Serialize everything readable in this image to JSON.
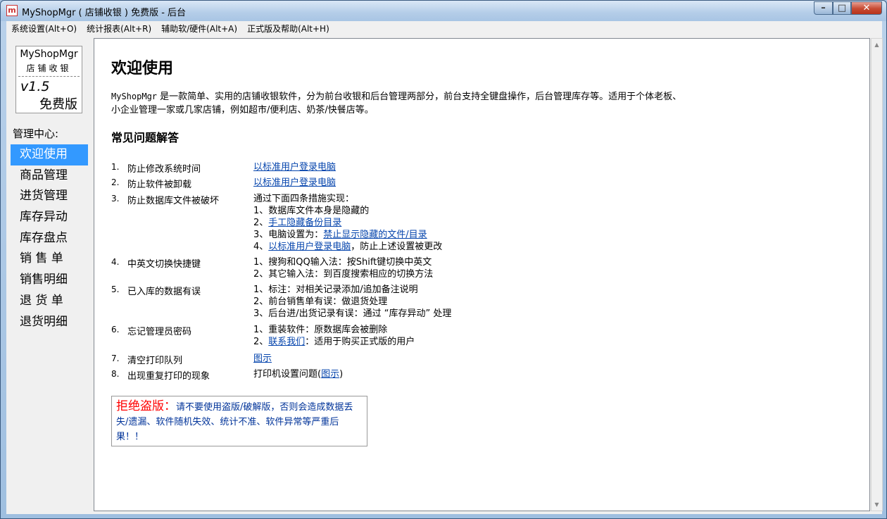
{
  "window": {
    "icon_glyph": "m",
    "title": "MyShopMgr ( 店铺收银 ) 免费版 - 后台",
    "btn_min": "–",
    "btn_max": "□",
    "btn_close": "✕"
  },
  "menu": [
    "系统设置(Alt+O)",
    "统计报表(Alt+R)",
    "辅助软/硬件(Alt+A)",
    "正式版及帮助(Alt+H)"
  ],
  "logo": {
    "name": "MyShopMgr",
    "sub": "店铺收银",
    "version": "v1.5",
    "edition": "免费版"
  },
  "nav": {
    "title": "管理中心:",
    "items": [
      "欢迎使用",
      "商品管理",
      "进货管理",
      "库存异动",
      "库存盘点",
      "销 售 单",
      "销售明细",
      "退 货 单",
      "退货明细"
    ],
    "active_index": 0
  },
  "main": {
    "heading": "欢迎使用",
    "intro_app": "MyShopMgr",
    "intro": " 是一款简单、实用的店铺收银软件，分为前台收银和后台管理两部分，前台支持全键盘操作，后台管理库存等。适用于个体老板、小企业管理一家或几家店铺，例如超市/便利店、奶茶/快餐店等。",
    "faq_heading": "常见问题解答",
    "faq": [
      {
        "num": "1.",
        "q": "防止修改系统时间",
        "a_link": "以标准用户登录电脑"
      },
      {
        "num": "2.",
        "q": "防止软件被卸载",
        "a_link": "以标准用户登录电脑"
      },
      {
        "num": "3.",
        "q": "防止数据库文件被破坏",
        "a_intro": "通过下面四条措施实现：",
        "a1": "1、数据库文件本身是隐藏的",
        "a2_pre": "2、",
        "a2_link": "手工隐藏备份目录",
        "a3_pre": "3、电脑设置为：",
        "a3_link": "禁止显示隐藏的文件/目录",
        "a4_pre": "4、",
        "a4_link": "以标准用户登录电脑",
        "a4_post": "，防止上述设置被更改"
      },
      {
        "num": "4.",
        "q": "中英文切换快捷键",
        "a1": "1、搜狗和QQ输入法：按Shift键切换中英文",
        "a2": "2、其它输入法：到百度搜索相应的切换方法"
      },
      {
        "num": "5.",
        "q": "已入库的数据有误",
        "a1": "1、标注：对相关记录添加/追加备注说明",
        "a2": "2、前台销售单有误：做退货处理",
        "a3": "3、后台进/出货记录有误：通过 “库存异动” 处理"
      },
      {
        "num": "6.",
        "q": "忘记管理员密码",
        "a1": "1、重装软件：原数据库会被删除",
        "a2_pre": "2、",
        "a2_link": "联系我们",
        "a2_post": "：适用于购买正式版的用户"
      },
      {
        "num": "7.",
        "q": "清空打印队列",
        "a_link": "图示"
      },
      {
        "num": "8.",
        "q": "出现重复打印的现象",
        "a_pre": "打印机设置问题(",
        "a_link": "图示",
        "a_post": ")"
      }
    ],
    "warning_strong": "拒绝盗版：",
    "warning_text": "请不要使用盗版/破解版，否则会造成数据丢失/遗漏、软件随机失效、统计不准、软件异常等严重后果！！"
  },
  "icons": {
    "scroll_up": "scroll-up-icon",
    "scroll_down": "scroll-down-icon"
  }
}
